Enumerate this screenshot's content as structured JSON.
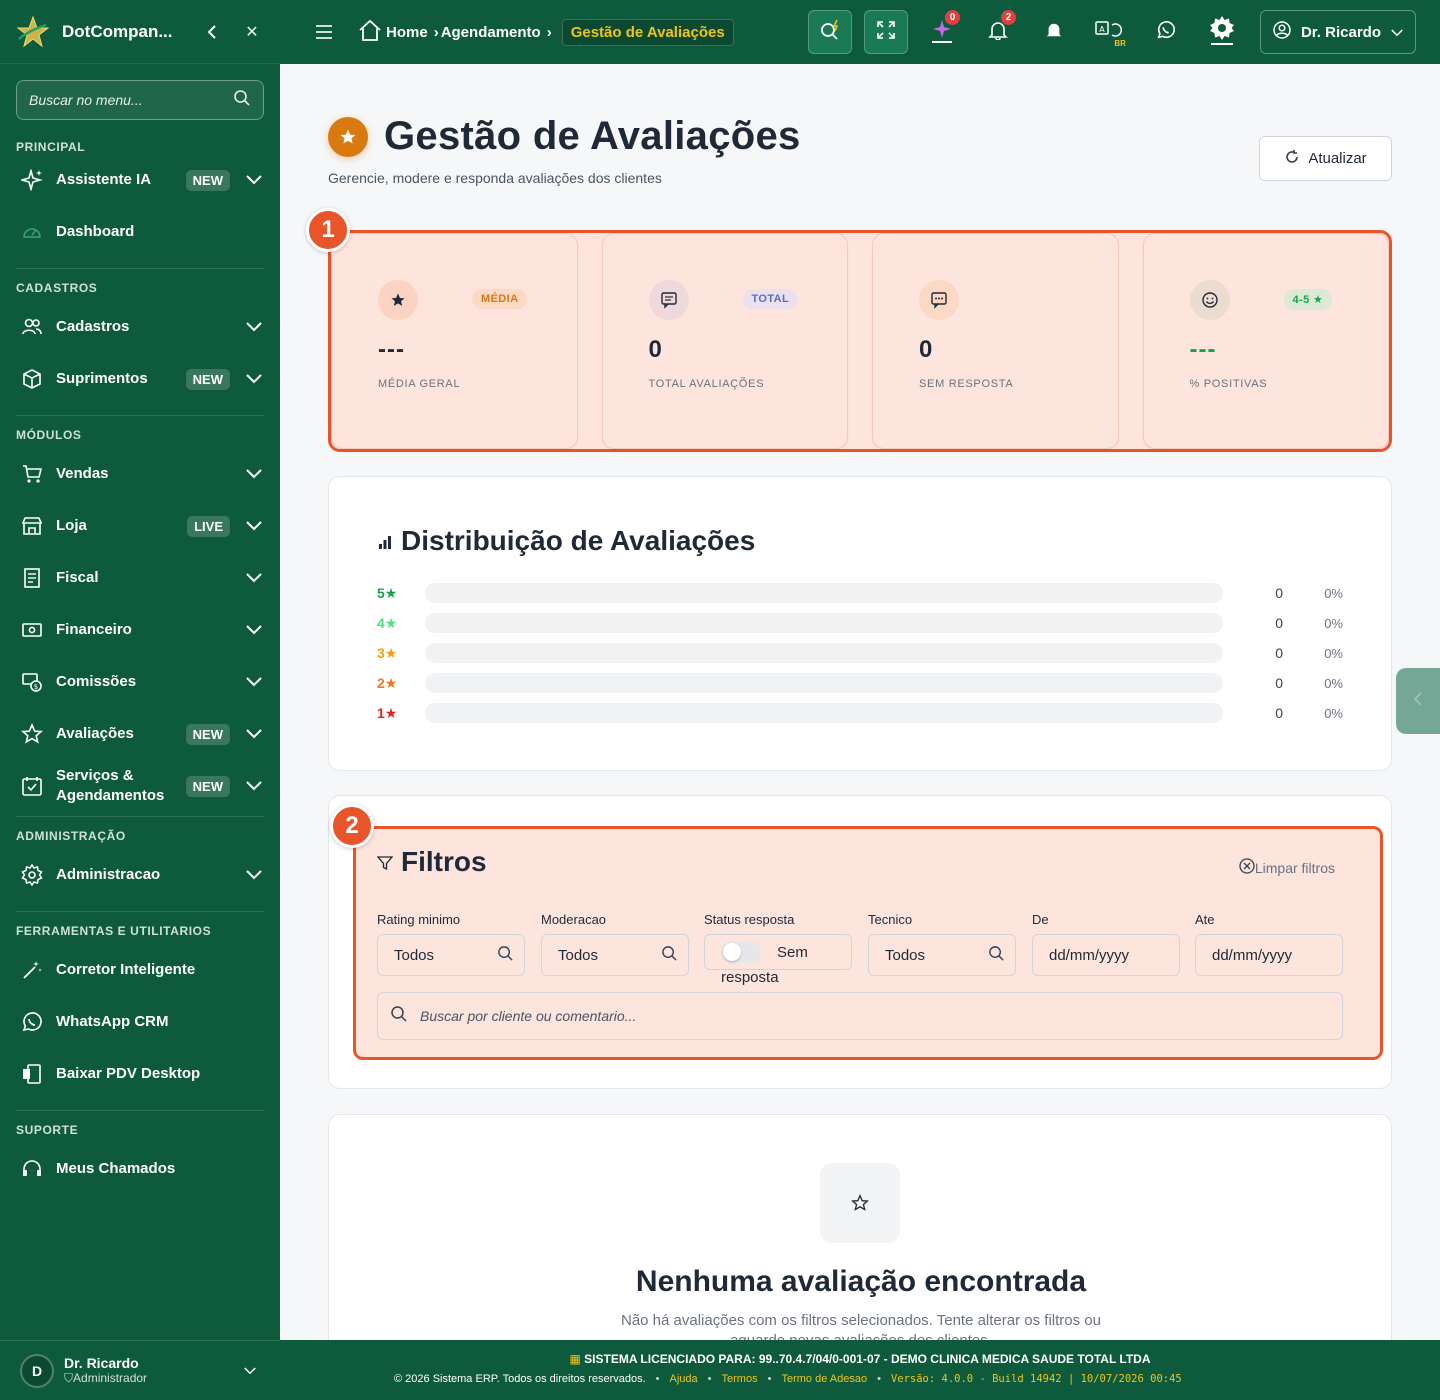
{
  "sidebar": {
    "brand": "DotCompan...",
    "search_placeholder": "Buscar no menu...",
    "sections": {
      "principal": "PRINCIPAL",
      "cadastros": "CADASTROS",
      "modulos": "MÓDULOS",
      "administracao": "ADMINISTRAÇÃO",
      "ferramentas": "FERRAMENTAS E UTILITARIOS",
      "suporte": "SUPORTE"
    },
    "items": {
      "assistente": {
        "label": "Assistente IA",
        "badge": "NEW"
      },
      "dashboard": {
        "label": "Dashboard"
      },
      "cadastros": {
        "label": "Cadastros"
      },
      "suprimentos": {
        "label": "Suprimentos",
        "badge": "NEW"
      },
      "vendas": {
        "label": "Vendas"
      },
      "loja": {
        "label": "Loja",
        "badge": "LIVE"
      },
      "fiscal": {
        "label": "Fiscal"
      },
      "financeiro": {
        "label": "Financeiro"
      },
      "comissoes": {
        "label": "Comissões"
      },
      "avaliacoes": {
        "label": "Avaliações",
        "badge": "NEW"
      },
      "servicos": {
        "label_line1": "Serviços &",
        "label_line2": "Agendamentos",
        "badge": "NEW"
      },
      "admin": {
        "label": "Administracao"
      },
      "corretor": {
        "label": "Corretor Inteligente"
      },
      "whatsapp": {
        "label": "WhatsApp CRM"
      },
      "pdv": {
        "label": "Baixar PDV Desktop"
      },
      "chamados": {
        "label": "Meus Chamados"
      }
    },
    "user": {
      "initial": "D",
      "name": "Dr. Ricardo",
      "role": "Administrador"
    }
  },
  "topbar": {
    "breadcrumb": [
      "Home",
      "Agendamento",
      "Gestão de Avaliações"
    ],
    "ai_count": "0",
    "notif_count": "2",
    "lang": "BR",
    "user": "Dr. Ricardo"
  },
  "page": {
    "title": "Gestão de Avaliações",
    "subtitle": "Gerencie, modere e responda avaliações dos clientes",
    "refresh_label": "Atualizar"
  },
  "annotations": {
    "stats": "1",
    "filters": "2"
  },
  "stats": [
    {
      "tag": "MÉDIA",
      "value": "---",
      "label": "MÉDIA GERAL",
      "icon": "star-icon"
    },
    {
      "tag": "TOTAL",
      "value": "0",
      "label": "TOTAL AVALIAÇÕES",
      "icon": "message-square-icon"
    },
    {
      "tag": "",
      "value": "0",
      "label": "SEM RESPOSTA",
      "icon": "message-dots-icon"
    },
    {
      "tag": "4-5 ★",
      "value": "---",
      "label": "% POSITIVAS",
      "icon": "smile-icon"
    }
  ],
  "colors": {
    "sidebar": "#0e5a3c",
    "highlight": "#e8552a",
    "accent_gold": "#f0c419"
  },
  "distribution": {
    "title": "Distribuição de Avaliações",
    "rows": [
      {
        "label": "5★",
        "count": "0",
        "pct": "0%",
        "fraction": 0,
        "color": "#16a34a"
      },
      {
        "label": "4★",
        "count": "0",
        "pct": "0%",
        "fraction": 0,
        "color": "#4ade80"
      },
      {
        "label": "3★",
        "count": "0",
        "pct": "0%",
        "fraction": 0,
        "color": "#f59e0b"
      },
      {
        "label": "2★",
        "count": "0",
        "pct": "0%",
        "fraction": 0,
        "color": "#f97316"
      },
      {
        "label": "1★",
        "count": "0",
        "pct": "0%",
        "fraction": 0,
        "color": "#dc2626"
      }
    ]
  },
  "filters": {
    "title": "Filtros",
    "clear_label": "Limpar filtros",
    "rating": {
      "label": "Rating minimo",
      "value": "Todos"
    },
    "moderacao": {
      "label": "Moderacao",
      "value": "Todos"
    },
    "status": {
      "label": "Status resposta",
      "value_line1": "Sem",
      "value_line2": "resposta"
    },
    "tecnico": {
      "label": "Tecnico",
      "value": "Todos"
    },
    "de": {
      "label": "De",
      "placeholder": "dd/mm/yyyy"
    },
    "ate": {
      "label": "Ate",
      "placeholder": "dd/mm/yyyy"
    },
    "search_placeholder": "Buscar por cliente ou comentario..."
  },
  "empty": {
    "title": "Nenhuma avaliação encontrada",
    "message": "Não há avaliações com os filtros selecionados. Tente alterar os filtros ou aguarde novas avaliações dos clientes."
  },
  "footer": {
    "license_prefix": "SISTEMA LICENCIADO PARA:",
    "license": "99..70.4.7/04/0-001-07 - DEMO CLINICA MEDICA SAUDE TOTAL LTDA",
    "copyright": "© 2026 Sistema ERP. Todos os direitos reservados.",
    "links": [
      "Ajuda",
      "Termos",
      "Termo de Adesao"
    ],
    "version": "Versão: 4.0.0 - Build 14942 | 10/07/2026 00:45"
  }
}
